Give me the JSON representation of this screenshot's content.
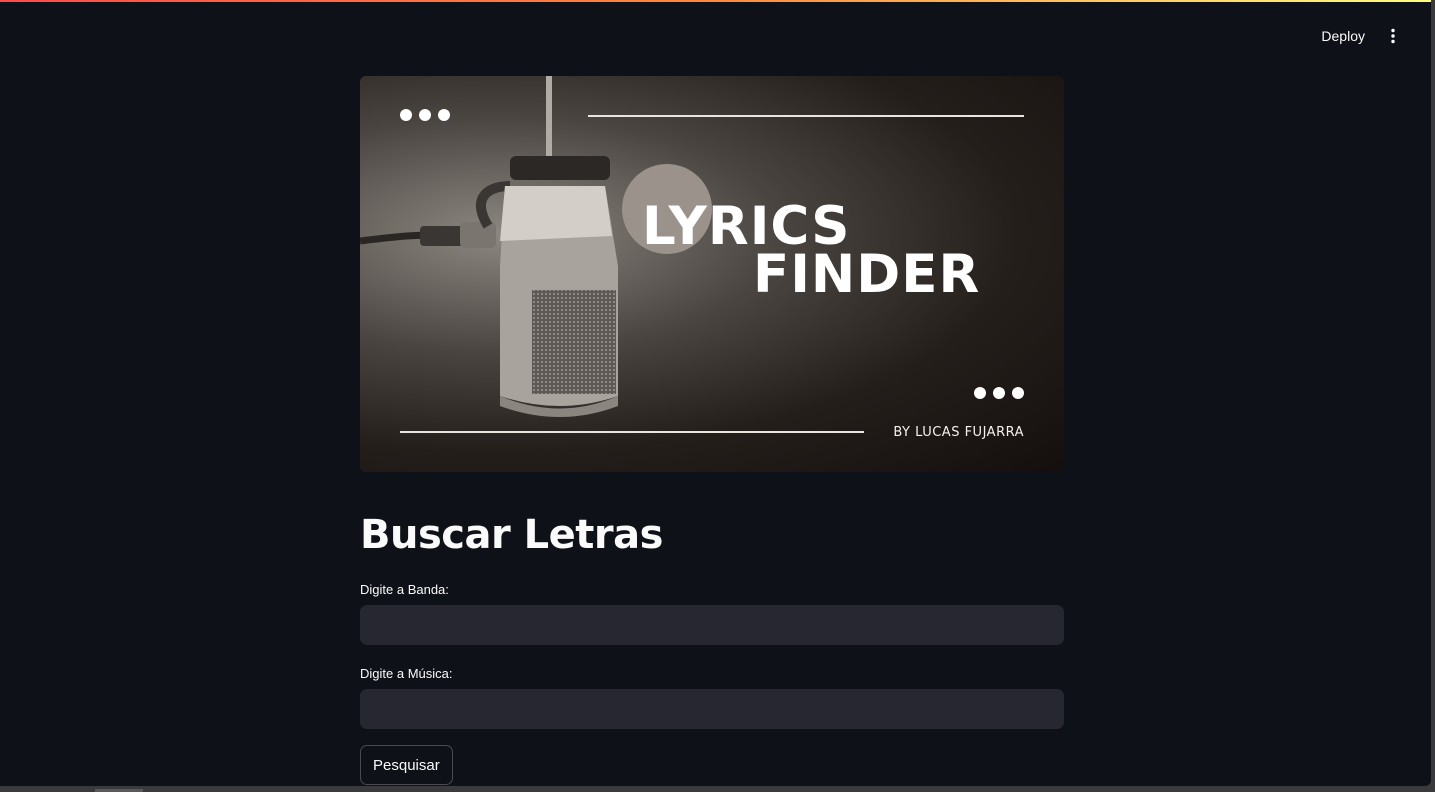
{
  "toolbar": {
    "deploy_label": "Deploy"
  },
  "banner": {
    "title_line1": "LYRICS",
    "title_line2": "FINDER",
    "byline": "BY LUCAS FUJARRA"
  },
  "main": {
    "title": "Buscar Letras",
    "band_label": "Digite a Banda:",
    "band_value": "",
    "song_label": "Digite a Música:",
    "song_value": "",
    "search_button": "Pesquisar"
  },
  "colors": {
    "background": "#0e1117",
    "input_bg": "#262730",
    "text": "#fafafa"
  }
}
